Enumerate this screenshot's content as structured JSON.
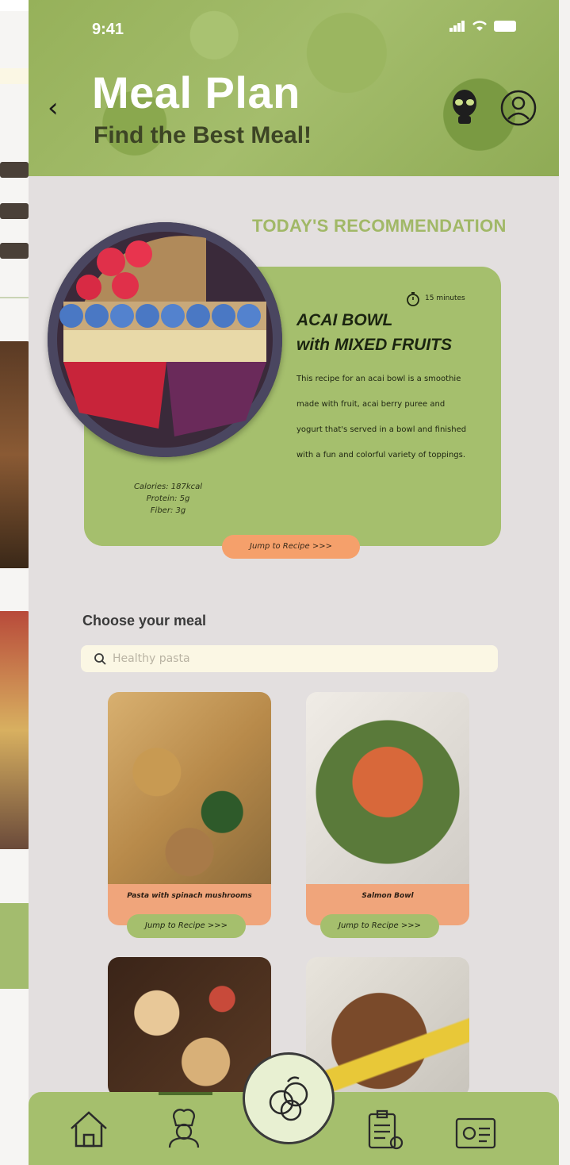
{
  "status": {
    "time": "9:41"
  },
  "header": {
    "title": "Meal Plan",
    "subtitle": "Find the Best Meal!"
  },
  "recommendation": {
    "section_title": "TODAY'S RECOMMENDATION",
    "time": "15 minutes",
    "name_line1": "ACAI BOWL",
    "name_line2": "with MIXED FRUITS",
    "description": "This recipe for an acai bowl is a smoothie made with fruit, acai berry puree and yogurt that's served in a bowl and finished with a fun and colorful variety of toppings.",
    "calories": "Calories: 187kcal",
    "protein": "Protein: 5g",
    "fiber": "Fiber: 3g",
    "jump_label": "Jump to Recipe >>>"
  },
  "choose": {
    "title": "Choose your meal",
    "search_placeholder": "Healthy pasta"
  },
  "meals": [
    {
      "name": "Pasta with spinach mushrooms",
      "jump_label": "Jump to Recipe >>>"
    },
    {
      "name": "Salmon Bowl",
      "jump_label": "Jump to Recipe >>>"
    }
  ],
  "colors": {
    "brand_green": "#a5bf6d",
    "accent_orange": "#f5a06b",
    "background": "#e3dfdf",
    "search_bg": "#fbf7e4"
  },
  "nav_icons": [
    "home-icon",
    "chef-icon",
    "meal-bowl-icon",
    "checklist-icon",
    "id-card-icon"
  ]
}
